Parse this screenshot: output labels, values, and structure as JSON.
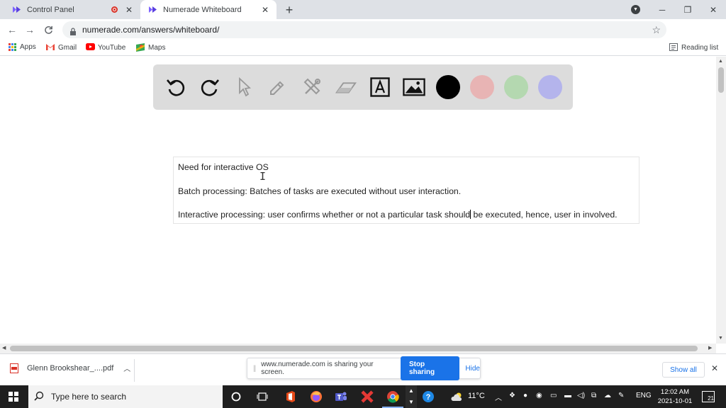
{
  "tabs": [
    {
      "title": "Control Panel",
      "recording": true
    },
    {
      "title": "Numerade Whiteboard",
      "active": true
    }
  ],
  "address": {
    "url": "numerade.com/answers/whiteboard/"
  },
  "profile": {
    "initial": "H"
  },
  "bookmarks": {
    "items": [
      "Apps",
      "Gmail",
      "YouTube",
      "Maps"
    ],
    "reading_list": "Reading list"
  },
  "whiteboard": {
    "tools": [
      "undo-icon",
      "redo-icon",
      "pointer-icon",
      "pen-icon",
      "tools-icon",
      "eraser-icon",
      "text-icon",
      "image-icon"
    ],
    "colors": [
      "#000000",
      "#e8b4b4",
      "#b4d8b0",
      "#b4b4ec"
    ],
    "text": {
      "line1": "Need for interactive OS",
      "line2": "Batch processing: Batches of tasks are executed without user interaction.",
      "line3_before_caret": "Interactive processing: user confirms whether or not a particular task should",
      "line3_after_caret": " be executed, hence, user in involved."
    }
  },
  "downloads": {
    "file": "Glenn Brookshear_....pdf",
    "share_message": "www.numerade.com is sharing your screen.",
    "stop_label": "Stop sharing",
    "hide_label": "Hide",
    "show_all_label": "Show all"
  },
  "taskbar": {
    "search_placeholder": "Type here to search",
    "weather": "11°C",
    "language": "ENG",
    "time": "12:02 AM",
    "date": "2021-10-01",
    "notifications": "21"
  }
}
